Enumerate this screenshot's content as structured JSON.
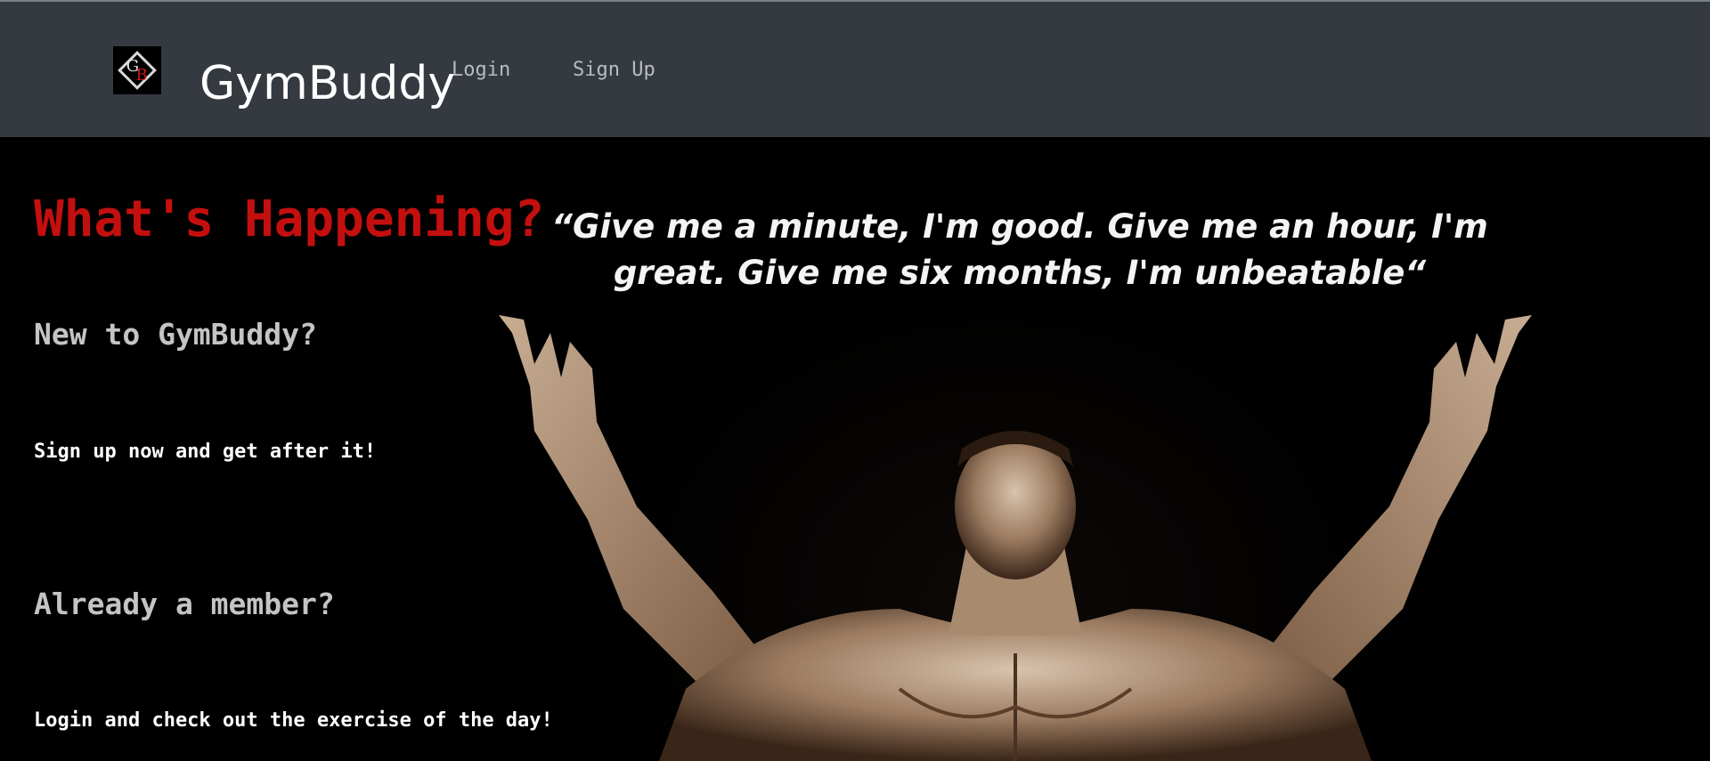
{
  "navbar": {
    "logo_text": "GB",
    "brand": "GymBuddy",
    "links": [
      {
        "label": "Login"
      },
      {
        "label": "Sign Up"
      }
    ]
  },
  "hero": {
    "heading": "What's Happening?",
    "quote": "“Give me a minute, I'm good. Give me an hour, I'm great. Give me six months, I'm unbeatable“",
    "new_heading": "New to GymBuddy?",
    "new_text": "Sign up now and get after it!",
    "member_heading": "Already a member?",
    "member_text": "Login and check out the exercise of the day!"
  },
  "colors": {
    "navbar_bg": "#343a40",
    "heading_red": "#c40f0f",
    "subheading_gray": "#c4c4c4",
    "nav_link": "#b8bcc0"
  }
}
